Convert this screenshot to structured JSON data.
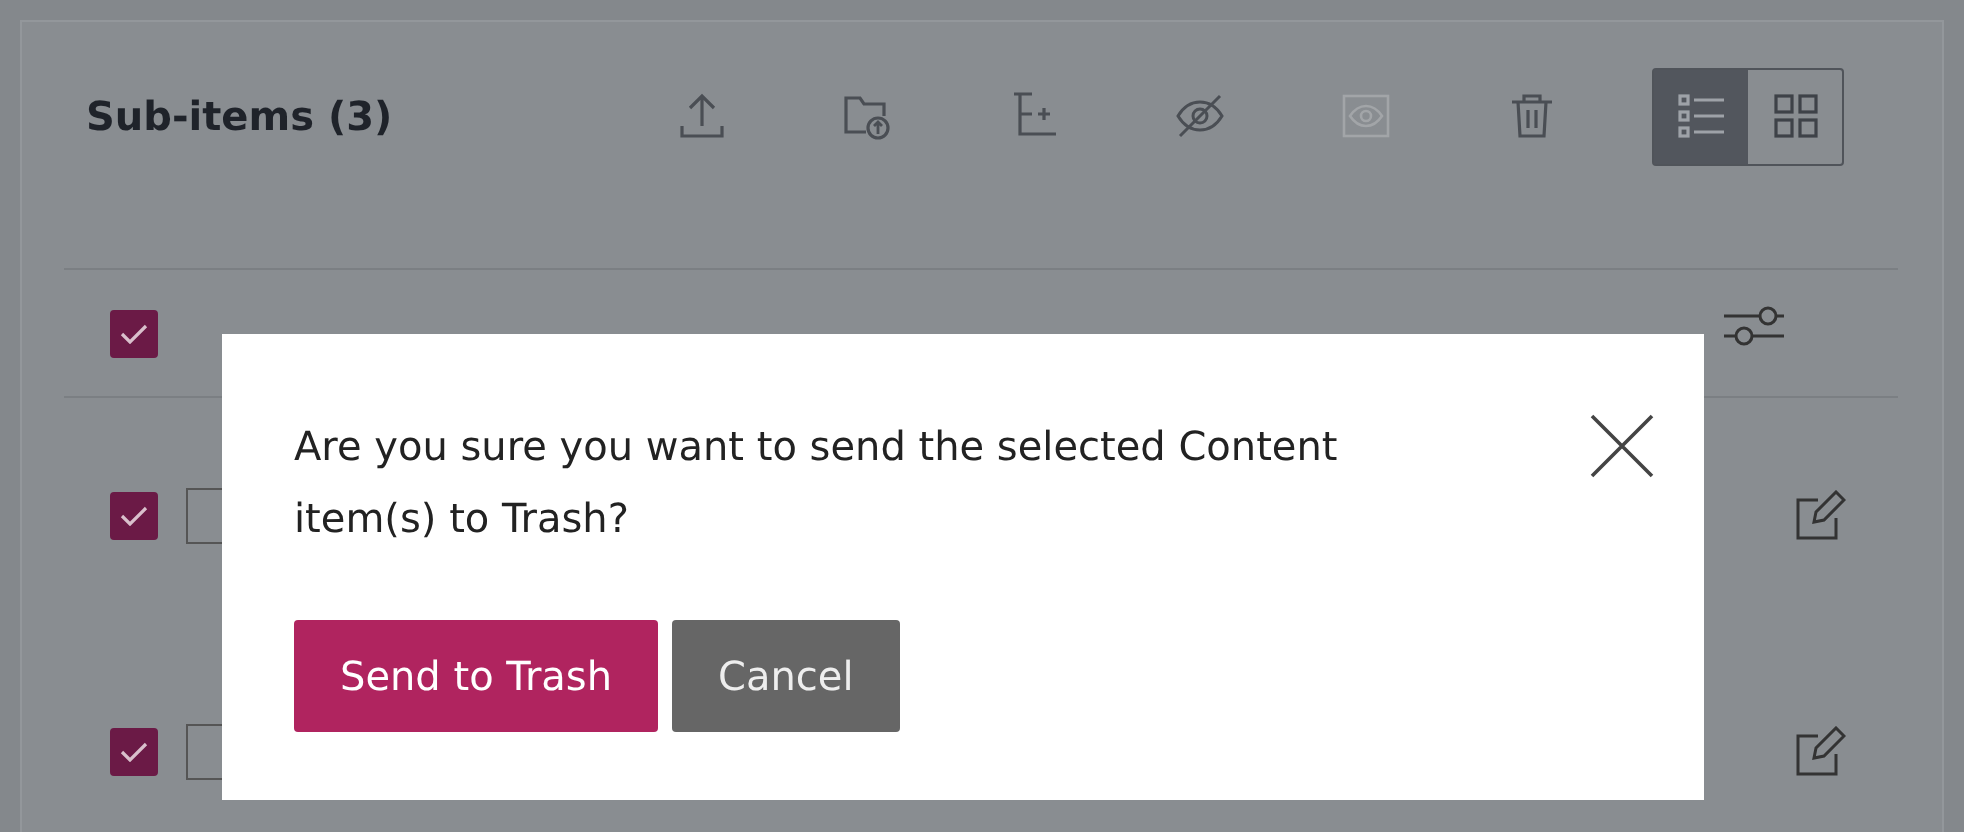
{
  "panel": {
    "title": "Sub-items (3)"
  },
  "toolbar": [
    {
      "kind": "upload",
      "disabled": false
    },
    {
      "kind": "folder-upload",
      "disabled": false
    },
    {
      "kind": "tree-add",
      "disabled": false
    },
    {
      "kind": "hide",
      "disabled": false
    },
    {
      "kind": "show",
      "disabled": true
    },
    {
      "kind": "trash",
      "disabled": false
    }
  ],
  "view_toggle": [
    {
      "kind": "list",
      "selected": true
    },
    {
      "kind": "grid",
      "selected": false
    }
  ],
  "table": {
    "select_all_checked": true,
    "rows": [
      {
        "checked": true
      },
      {
        "checked": true
      }
    ]
  },
  "dialog": {
    "message": "Are you sure you want to send the selected Content item(s) to Trash?",
    "buttons": [
      {
        "label": "Send to Trash",
        "kind": "primary"
      },
      {
        "label": "Cancel",
        "kind": "secondary"
      }
    ]
  }
}
